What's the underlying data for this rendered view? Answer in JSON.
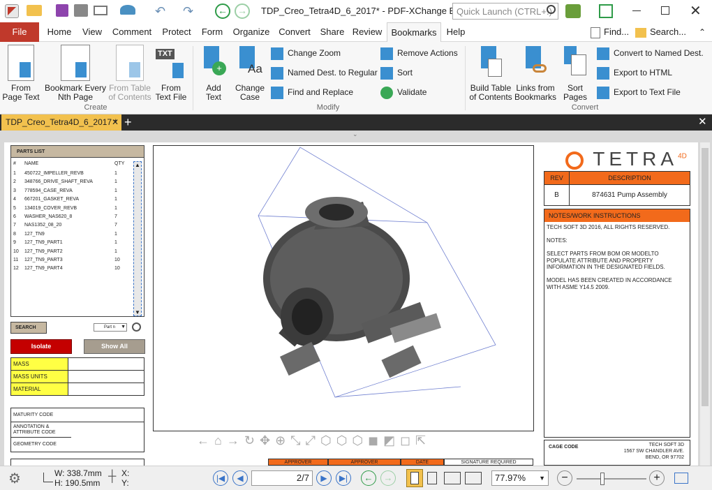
{
  "title": {
    "doc": "TDP_Creo_Tetra4D_6_2017*",
    "app": "PDF-XChange Editor",
    "search_placeholder": "Quick Launch (CTRL+.)"
  },
  "menu": {
    "file": "File",
    "tabs": [
      "Home",
      "View",
      "Comment",
      "Protect",
      "Form",
      "Organize",
      "Convert",
      "Share",
      "Review",
      "Bookmarks",
      "Help"
    ],
    "find": "Find...",
    "search": "Search..."
  },
  "ribbon": {
    "create": {
      "from_page_text": [
        "From",
        "Page Text"
      ],
      "every_nth": [
        "Bookmark Every",
        "Nth Page"
      ],
      "from_toc": [
        "From Table",
        "of Contents"
      ],
      "from_text": [
        "From",
        "Text File"
      ],
      "label": "Create"
    },
    "modify": {
      "add_text": [
        "Add",
        "Text"
      ],
      "change_case": [
        "Change",
        "Case"
      ],
      "change_zoom": "Change Zoom",
      "named_dest": "Named Dest. to Regular",
      "find_replace": "Find and Replace",
      "remove_actions": "Remove Actions",
      "sort": "Sort",
      "validate": "Validate",
      "label": "Modify"
    },
    "convert": {
      "build_toc": [
        "Build Table",
        "of Contents"
      ],
      "links_from": [
        "Links from",
        "Bookmarks"
      ],
      "sort_pages": [
        "Sort",
        "Pages"
      ],
      "to_named": "Convert to Named Dest.",
      "to_html": "Export to HTML",
      "to_text": "Export to Text File",
      "label": "Convert"
    }
  },
  "doc_tab": "TDP_Creo_Tetra4D_6_2017 *",
  "parts": {
    "header": "PARTS LIST",
    "cols": [
      "#",
      "NAME",
      "QTY"
    ],
    "rows": [
      [
        "1",
        "450722_IMPELLER_REVB",
        "1"
      ],
      [
        "2",
        "348766_DRIVE_SHAFT_REVA",
        "1"
      ],
      [
        "3",
        "778594_CASE_REVA",
        "1"
      ],
      [
        "4",
        "667201_GASKET_REVA",
        "1"
      ],
      [
        "5",
        "134019_COVER_REVB",
        "1"
      ],
      [
        "6",
        "WASHER_NAS620_8",
        "7"
      ],
      [
        "7",
        "NAS1352_08_20",
        "7"
      ],
      [
        "8",
        "127_TN9",
        "1"
      ],
      [
        "9",
        "127_TN9_PART1",
        "1"
      ],
      [
        "10",
        "127_TN9_PART2",
        "1"
      ],
      [
        "11",
        "127_TN9_PART3",
        "10"
      ],
      [
        "12",
        "127_TN9_PART4",
        "10"
      ]
    ],
    "search": "SEARCH",
    "search_val": "Part n",
    "isolate": "Isolate",
    "show_all": "Show All"
  },
  "props": [
    "MASS",
    "MASS UNITS",
    "MATERIAL"
  ],
  "codes": [
    "MATURITY CODE",
    "ANNOTATION & ATTRIBUTE CODE",
    "GEOMETRY CODE"
  ],
  "logo": "TETRA",
  "logo_sup": "4D",
  "rev": {
    "h1": "REV",
    "h2": "DESCRIPTION",
    "v1": "B",
    "v2": "874631 Pump Assembly"
  },
  "notes": {
    "header": "NOTES/WORK INSTRUCTIONS",
    "l1": "TECH SOFT 3D 2016, ALL RIGHTS RESERVED.",
    "l2": "NOTES:",
    "l3": "SELECT PARTS  FROM BOM OR MODELTO POPULATE ATTRIBUTE AND PROPERTY INFORMATION IN THE DESIGNATED FIELDS.",
    "l4": "MODEL HAS BEEN CREATED IN ACCORDANCE WITH ASME Y14.5 2009."
  },
  "cage": {
    "label": "CAGE CODE",
    "a1": "TECH SOFT 3D",
    "a2": "1567 SW CHANDLER AVE.",
    "a3": "BEND, OR 97702"
  },
  "approve": [
    "APPROVER",
    "APPROVER",
    "DATE",
    "SIGNATURE REQUIRED"
  ],
  "status": {
    "w": "W: 338.7mm",
    "h": "H: 190.5mm",
    "x": "X:",
    "y": "Y:",
    "page": "2/7",
    "zoom": "77.97%"
  },
  "colors": {
    "accent": "#c0392b",
    "orange": "#f26a1b"
  }
}
